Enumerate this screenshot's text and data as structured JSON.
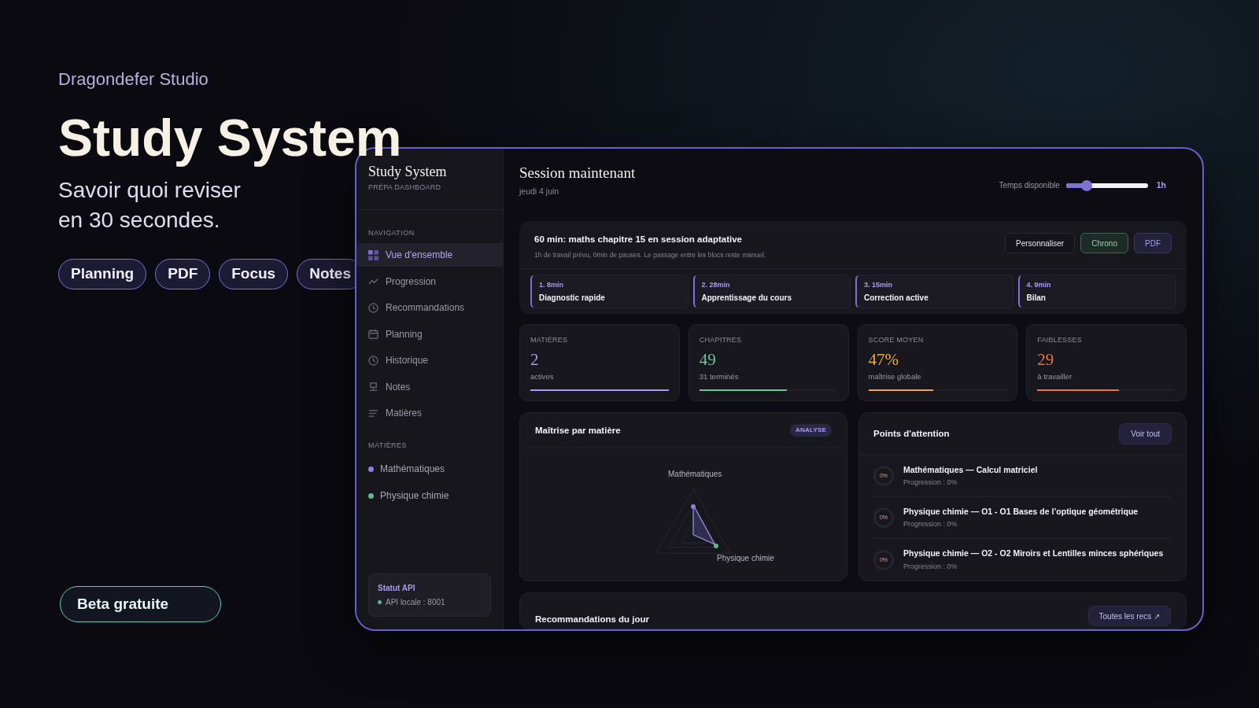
{
  "hero": {
    "studio": "Dragondefer Studio",
    "title": "Study System",
    "tagline_lines": [
      "Savoir quoi reviser",
      "en 30 secondes."
    ],
    "features": [
      "Planning",
      "PDF",
      "Focus",
      "Notes"
    ],
    "cta": "Beta gratuite"
  },
  "app": {
    "brand": "Study System",
    "brand_sub": "PRÉPA DASHBOARD",
    "sidebar": {
      "nav_heading": "NAVIGATION",
      "items": [
        {
          "label": "Vue d'ensemble",
          "selected": true
        },
        {
          "label": "Progression",
          "selected": false
        },
        {
          "label": "Recommandations",
          "selected": false
        },
        {
          "label": "Planning",
          "selected": false
        },
        {
          "label": "Historique",
          "selected": false
        },
        {
          "label": "Notes",
          "selected": false
        },
        {
          "label": "Matières",
          "selected": false
        }
      ],
      "subjects_heading": "MATIÈRES",
      "subjects": [
        {
          "label": "Mathématiques",
          "color": "#8b7fe0"
        },
        {
          "label": "Physique chimie",
          "color": "#5fb88a"
        }
      ],
      "api": {
        "title": "Statut API",
        "status": "API locale : 8001"
      }
    },
    "header": {
      "title": "Session maintenant",
      "date": "jeudi 4 juin",
      "time_label": "Temps disponible",
      "time_slider": {
        "level": 0.25
      },
      "time_value": "1h"
    },
    "session": {
      "title": "60 min: maths chapitre 15 en session adaptative",
      "subtitle": "1h de travail prévu, 0min de pauses. Le passage entre les blocs reste manuel.",
      "buttons": [
        {
          "label": "Personnaliser",
          "kind": "plain"
        },
        {
          "label": "Chrono",
          "kind": "green"
        },
        {
          "label": "PDF",
          "kind": "violet"
        }
      ],
      "blocks": [
        {
          "time": "1. 8min",
          "label": "Diagnostic rapide"
        },
        {
          "time": "2. 28min",
          "label": "Apprentissage du cours"
        },
        {
          "time": "3. 15min",
          "label": "Correction active"
        },
        {
          "time": "4. 9min",
          "label": "Bilan"
        }
      ]
    },
    "stats": [
      {
        "label": "MATIÈRES",
        "value": "2",
        "note": "actives",
        "color": "#a89cf0",
        "level": 1.0
      },
      {
        "label": "CHAPITRES",
        "value": "49",
        "note": "31 terminés",
        "color": "#6fc49a",
        "level": 0.63
      },
      {
        "label": "SCORE MOYEN",
        "value": "47%",
        "note": "maîtrise globale",
        "color": "#e8a94a",
        "level": 0.47
      },
      {
        "label": "FAIBLESSES",
        "value": "29",
        "note": "à travailler",
        "color": "#e0784a",
        "level": 0.59
      }
    ],
    "mastery": {
      "title": "Maîtrise par matière",
      "badge": "ANALYSE",
      "axes": [
        {
          "label": "Mathématiques",
          "color": "#8b7fe0"
        },
        {
          "label": "Physique chimie",
          "color": "#5fb88a"
        }
      ]
    },
    "attention": {
      "title": "Points d'attention",
      "button": "Voir tout",
      "items": [
        {
          "ring": "0%",
          "title": "Mathématiques — Calcul matriciel",
          "detail": "Progression : 0%"
        },
        {
          "ring": "0%",
          "title": "Physique chimie — O1 - O1 Bases de l’optique géométrique",
          "detail": "Progression : 0%"
        },
        {
          "ring": "0%",
          "title": "Physique chimie — O2 - O2 Miroirs et Lentilles minces sphériques",
          "detail": "Progression : 0%"
        }
      ]
    },
    "recommendations": {
      "title": "Recommandations du jour",
      "button": "Toutes les recs ↗"
    }
  }
}
